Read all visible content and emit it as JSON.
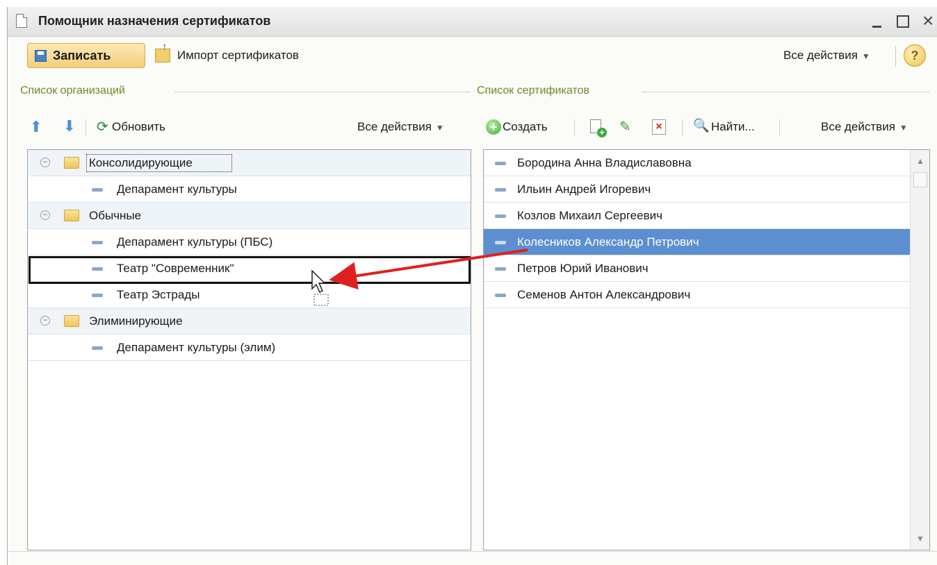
{
  "window": {
    "title": "Помощник назначения сертификатов"
  },
  "toolbar": {
    "save_label": "Записать",
    "import_label": "Импорт сертификатов",
    "all_actions": "Все действия",
    "help": "?"
  },
  "organizations": {
    "group_title": "Список организаций",
    "refresh_label": "Обновить",
    "all_actions": "Все действия",
    "rows": [
      {
        "label": "Консолидирующие",
        "type": "group"
      },
      {
        "label": "Депарамент культуры",
        "type": "item"
      },
      {
        "label": "Обычные",
        "type": "group"
      },
      {
        "label": "Депарамент культуры (ПБС)",
        "type": "item"
      },
      {
        "label": "Театр \"Современник\"",
        "type": "item"
      },
      {
        "label": "Театр Эстрады",
        "type": "item"
      },
      {
        "label": "Элиминирующие",
        "type": "group"
      },
      {
        "label": "Депарамент культуры (элим)",
        "type": "item"
      }
    ]
  },
  "certificates": {
    "group_title": "Список сертификатов",
    "create_label": "Создать",
    "find_label": "Найти...",
    "all_actions": "Все действия",
    "rows": [
      {
        "label": "Бородина Анна Владиславовна"
      },
      {
        "label": "Ильин Андрей Игоревич"
      },
      {
        "label": "Козлов Михаил Сергеевич"
      },
      {
        "label": "Колесников Александр Петрович",
        "selected": true
      },
      {
        "label": "Петров Юрий Иванович"
      },
      {
        "label": "Семенов Антон Александрович"
      }
    ]
  },
  "colors": {
    "selection": "#5b8fd1",
    "annotation_arrow": "#e02020"
  }
}
